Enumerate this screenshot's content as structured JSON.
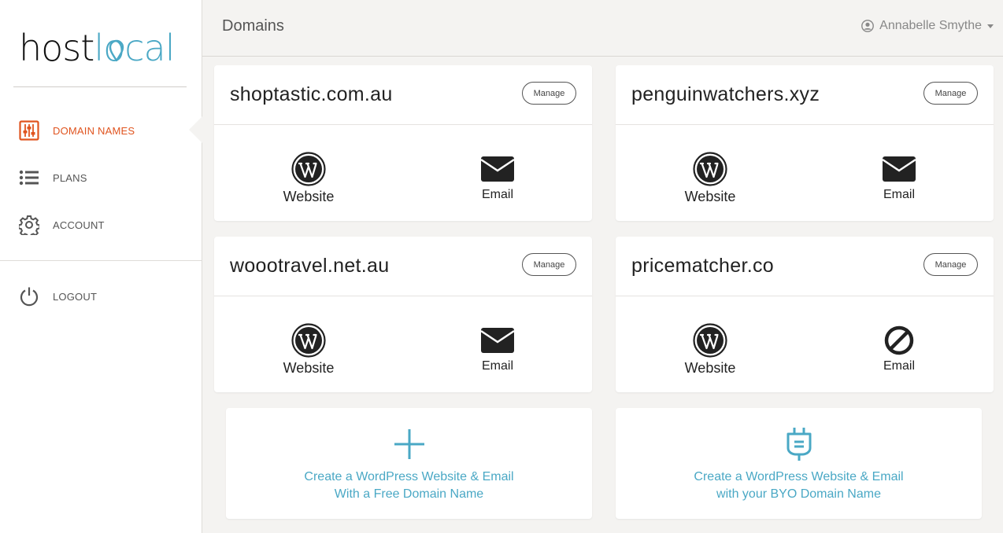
{
  "brand": {
    "logo_part1": "host",
    "logo_part2": "local",
    "accent": "#4aa8c5",
    "active_color": "#e0541f"
  },
  "sidebar": {
    "items": [
      {
        "label": "DOMAIN NAMES",
        "icon": "sliders-icon",
        "active": true
      },
      {
        "label": "PLANS",
        "icon": "list-icon",
        "active": false
      },
      {
        "label": "ACCOUNT",
        "icon": "gear-icon",
        "active": false
      }
    ],
    "logout_label": "LOGOUT"
  },
  "header": {
    "title": "Domains",
    "user_name": "Annabelle Smythe"
  },
  "domains": [
    {
      "name": "shoptastic.com.au",
      "manage_label": "Manage",
      "website_label": "Website",
      "email_label": "Email",
      "email_status": "active"
    },
    {
      "name": "penguinwatchers.xyz",
      "manage_label": "Manage",
      "website_label": "Website",
      "email_label": "Email",
      "email_status": "active"
    },
    {
      "name": "woootravel.net.au",
      "manage_label": "Manage",
      "website_label": "Website",
      "email_label": "Email",
      "email_status": "active"
    },
    {
      "name": "pricematcher.co",
      "manage_label": "Manage",
      "website_label": "Website",
      "email_label": "Email",
      "email_status": "disabled"
    }
  ],
  "cta": [
    {
      "icon": "plus-icon",
      "line1": "Create a WordPress Website & Email",
      "line2": "With a Free Domain Name"
    },
    {
      "icon": "plug-icon",
      "line1": "Create a WordPress Website & Email",
      "line2": "with your BYO Domain Name"
    }
  ]
}
